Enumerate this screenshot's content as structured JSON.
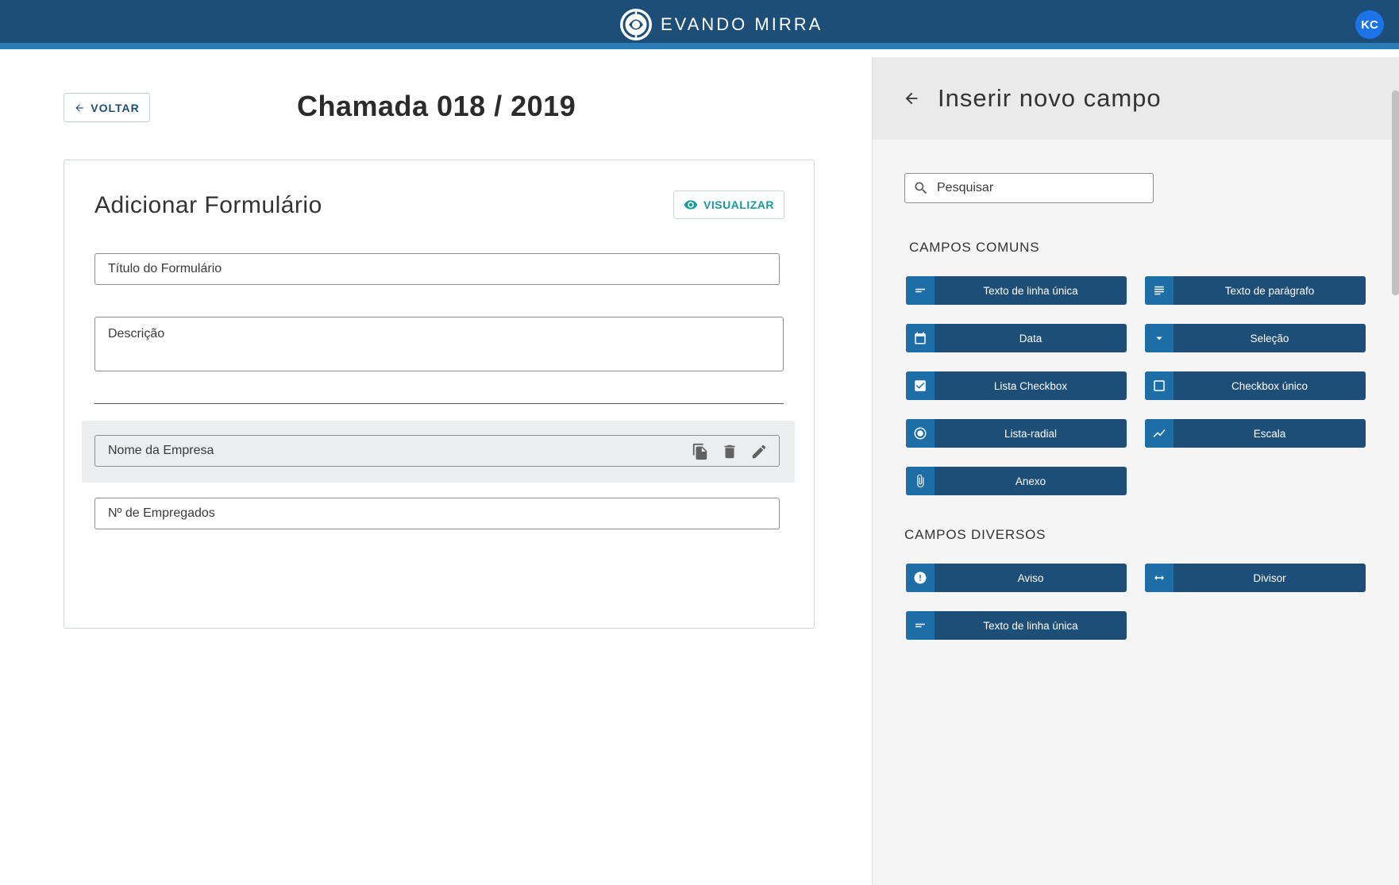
{
  "header": {
    "brand": "EVANDO MIRRA",
    "avatar_initials": "KC",
    "colors": {
      "bar": "#1c4e78",
      "stripe": "#2a7ab8",
      "avatar": "#1a73e8"
    }
  },
  "main": {
    "back_label": "VOLTAR",
    "page_title": "Chamada 018 / 2019",
    "card": {
      "title": "Adicionar Formulário",
      "preview_label": "VISUALIZAR",
      "form_title_placeholder": "Título do Formulário",
      "description_placeholder": "Descrição",
      "fields": [
        {
          "label": "Nome da Empresa",
          "selected": true
        },
        {
          "label": "Nº de Empregados",
          "selected": false
        }
      ]
    }
  },
  "panel": {
    "title": "Inserir novo campo",
    "search_placeholder": "Pesquisar",
    "common_title": "CAMPOS COMUNS",
    "common_fields": [
      {
        "label": "Texto de linha única",
        "icon": "short-text-icon"
      },
      {
        "label": "Texto de parágrafo",
        "icon": "paragraph-icon"
      },
      {
        "label": "Data",
        "icon": "calendar-icon"
      },
      {
        "label": "Seleção",
        "icon": "dropdown-icon"
      },
      {
        "label": "Lista Checkbox",
        "icon": "checkbox-checked-icon"
      },
      {
        "label": "Checkbox único",
        "icon": "checkbox-empty-icon"
      },
      {
        "label": "Lista-radial",
        "icon": "radio-icon"
      },
      {
        "label": "Escala",
        "icon": "trending-icon"
      },
      {
        "label": "Anexo",
        "icon": "paperclip-icon"
      }
    ],
    "misc_title": "CAMPOS DIVERSOS",
    "misc_fields": [
      {
        "label": "Aviso",
        "icon": "alert-icon"
      },
      {
        "label": "Divisor",
        "icon": "horizontal-arrows-icon"
      },
      {
        "label": "Texto de linha única",
        "icon": "short-text-icon"
      }
    ],
    "colors": {
      "button": "#1c4e78",
      "icon_bg": "#1d6ea6"
    }
  }
}
